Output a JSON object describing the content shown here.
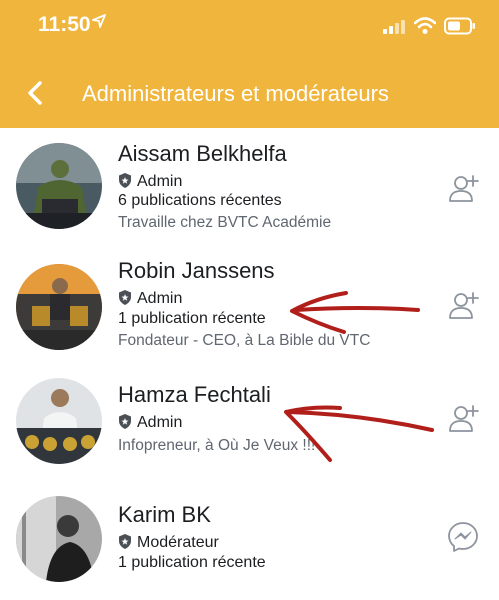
{
  "status_bar": {
    "time": "11:50"
  },
  "header": {
    "title": "Administrateurs et modérateurs"
  },
  "colors": {
    "header_bg": "#f0b53c",
    "annotation": "#b01f1a"
  },
  "members": [
    {
      "name": "Aissam Belkhelfa",
      "role": "Admin",
      "posts": "6 publications récentes",
      "detail": "Travaille chez BVTC Académie",
      "action_icon": "add-friend-icon"
    },
    {
      "name": "Robin Janssens",
      "role": "Admin",
      "posts": "1 publication récente",
      "detail": "Fondateur - CEO, à La Bible du VTC",
      "action_icon": "add-friend-icon"
    },
    {
      "name": "Hamza Fechtali",
      "role": "Admin",
      "posts": "",
      "detail": "Infopreneur, à Où Je Veux !!!",
      "action_icon": "add-friend-icon"
    },
    {
      "name": "Karim BK",
      "role": "Modérateur",
      "posts": "1 publication récente",
      "detail": "",
      "action_icon": "messenger-icon"
    }
  ]
}
